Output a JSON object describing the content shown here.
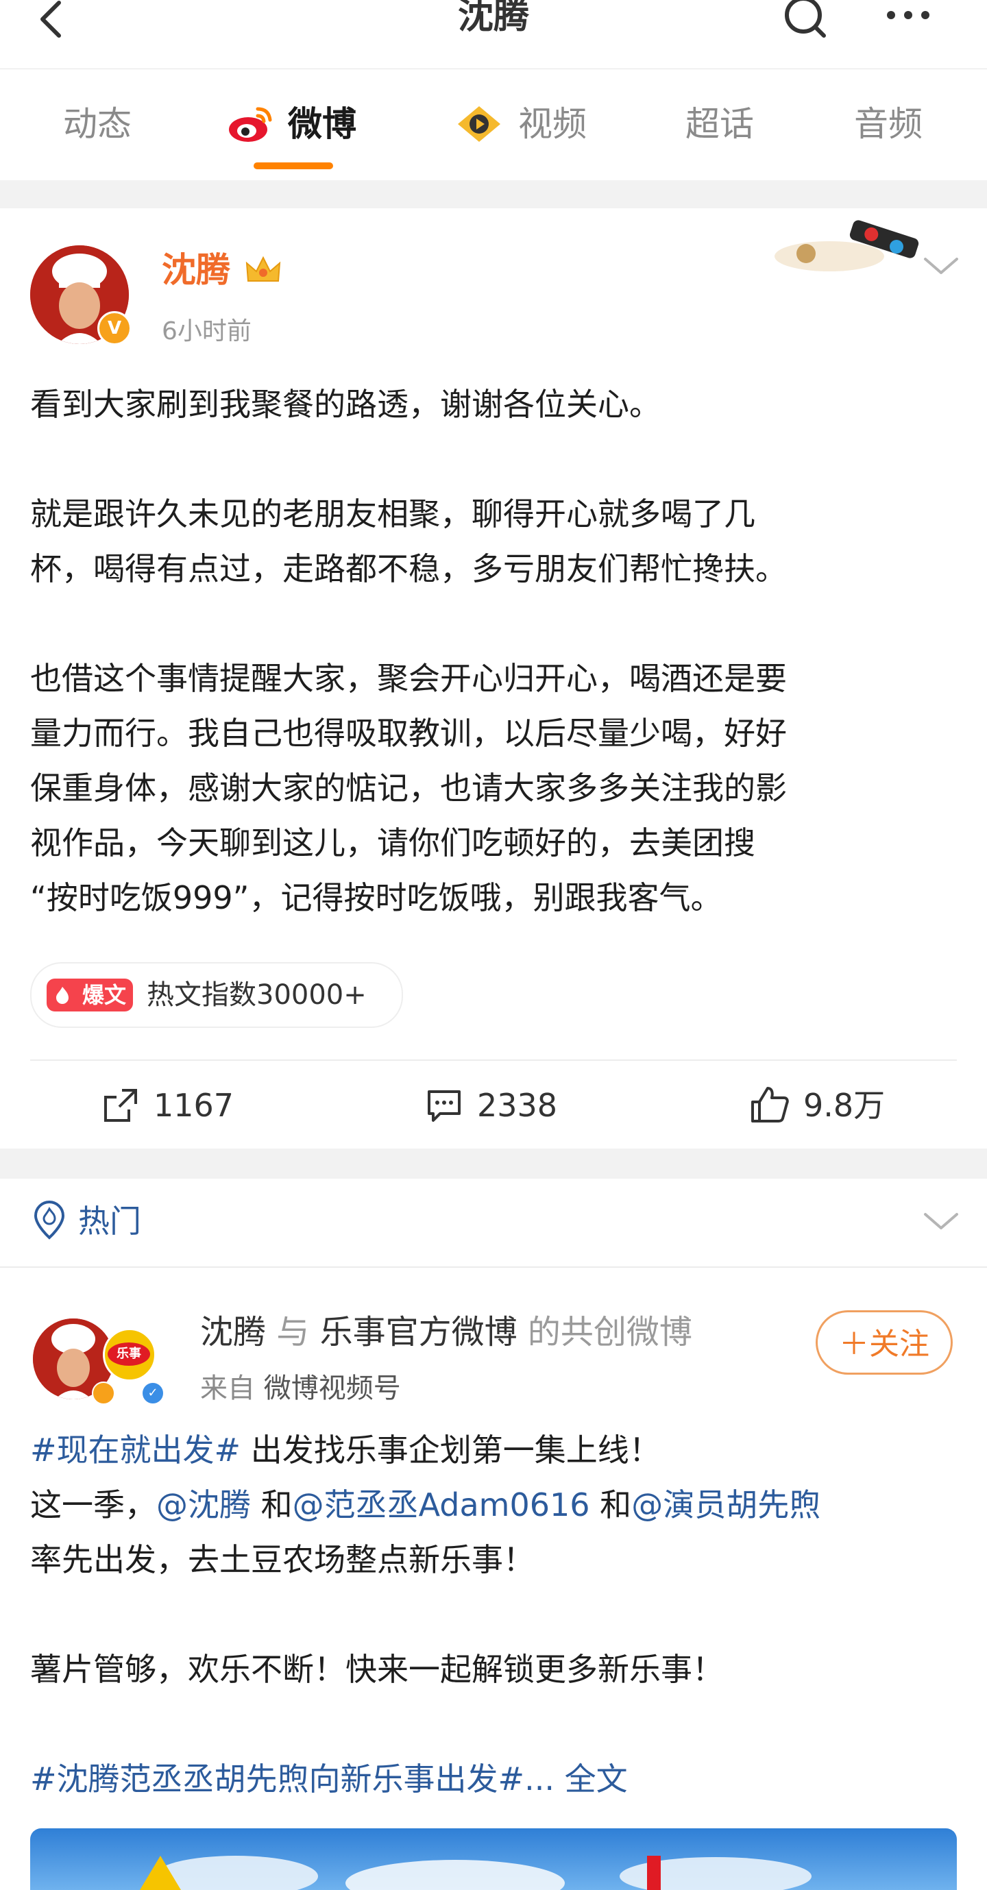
{
  "header": {
    "title": "沈腾"
  },
  "tabs": [
    {
      "label": "动态",
      "active": false
    },
    {
      "label": "微博",
      "active": true
    },
    {
      "label": "视频",
      "active": false
    },
    {
      "label": "超话",
      "active": false
    },
    {
      "label": "音频",
      "active": false
    }
  ],
  "post": {
    "author": "沈腾",
    "time": "6小时前",
    "paragraphs": [
      "看到大家刷到我聚餐的路透，谢谢各位关心。",
      "就是跟许久未见的老朋友相聚，聊得开心就多喝了几\n杯，喝得有点过，走路都不稳，多亏朋友们帮忙搀扶。",
      "也借这个事情提醒大家，聚会开心归开心，喝酒还是要\n量力而行。我自己也得吸取教训，以后尽量少喝，好好\n保重身体，感谢大家的惦记，也请大家多多关注我的影\n视作品，今天聊到这儿，请你们吃顿好的，去美团搜\n“按时吃饭999”，记得按时吃饭哦，别跟我客气。"
    ],
    "hot_tag": "爆文",
    "hot_index": "热文指数30000+",
    "reposts": "1167",
    "comments": "2338",
    "likes": "9.8万"
  },
  "section": {
    "label": "热门"
  },
  "post2": {
    "author": "沈腾",
    "conj": "与",
    "coauthor": "乐事官方微博",
    "suffix": "的共创微博",
    "from_prefix": "来自",
    "from_source": "微博视频号",
    "follow_label": "＋关注",
    "line1_tag": "#现在就出发#",
    "line1_rest": " 出发找乐事企划第一集上线！",
    "line2_pre": "这一季，",
    "mention1": "@沈腾",
    "and1": " 和",
    "mention2": "@范丞丞Adam0616",
    "and2": " 和",
    "mention3": "@演员胡先煦",
    "line3": "率先出发，去土豆农场整点新乐事！",
    "line4": "薯片管够，欢乐不断！快来一起解锁更多新乐事！",
    "line5_tag": "#沈腾范丞丞胡先煦向新乐事出发#",
    "ellipsis": "...",
    "full_text": "全文"
  },
  "colors": {
    "accent": "#ff8200",
    "link": "#2c5b9c",
    "name": "#f06b2a",
    "hot": "#f5434c"
  }
}
